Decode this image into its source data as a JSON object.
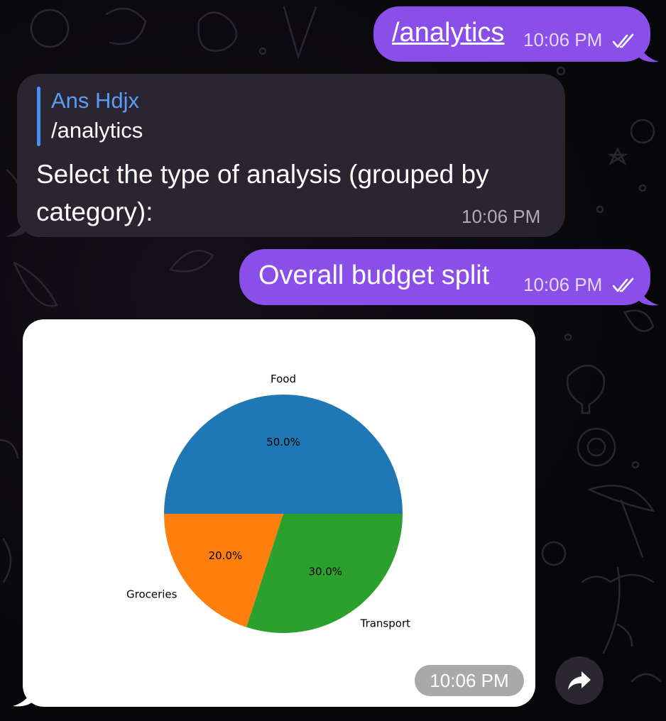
{
  "messages": {
    "m1": {
      "text": "/analytics",
      "time": "10:06 PM"
    },
    "m2": {
      "reply_sender": "Ans Hdjx",
      "reply_text": "/analytics",
      "text": "Select the type of analysis (grouped by category):",
      "time": "10:06 PM"
    },
    "m3": {
      "text": "Overall budget split",
      "time": "10:06 PM"
    },
    "m4": {
      "time": "10:06 PM"
    }
  },
  "icons": {
    "read_status": "double-check-icon",
    "forward": "forward-arrow-icon"
  },
  "colors": {
    "outgoing_bubble": "#8a4fe8",
    "incoming_bubble": "#2a2530",
    "reply_accent": "#5b9cf4"
  },
  "chart_data": {
    "type": "pie",
    "categories": [
      "Food",
      "Groceries",
      "Transport"
    ],
    "values": [
      50.0,
      20.0,
      30.0
    ],
    "labels": [
      "50.0%",
      "20.0%",
      "30.0%"
    ],
    "colors": [
      "#1f77b4",
      "#ff7f0e",
      "#2ca02c"
    ]
  }
}
